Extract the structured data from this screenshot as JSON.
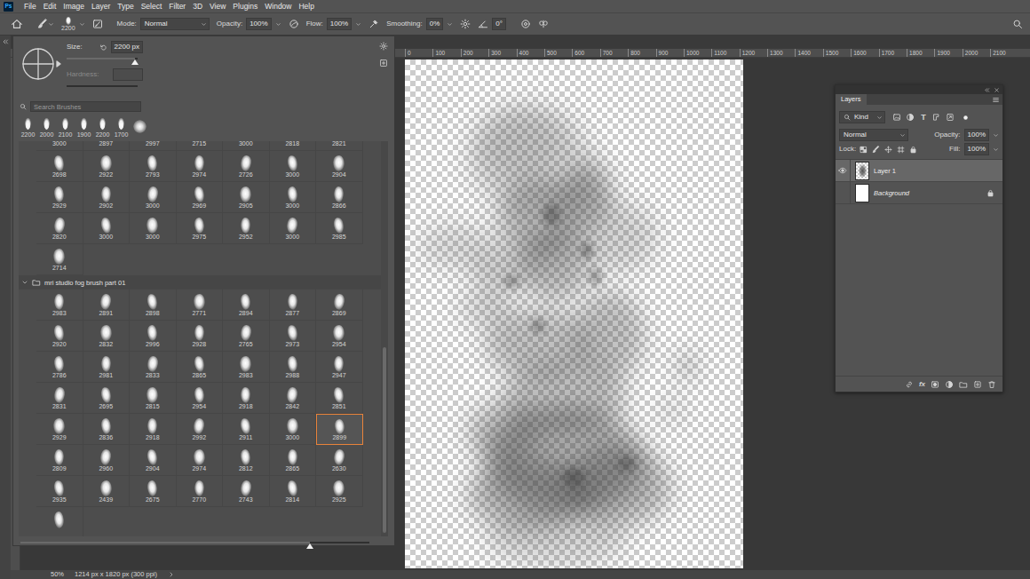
{
  "app": {
    "logo": "Ps"
  },
  "menu": [
    "File",
    "Edit",
    "Image",
    "Layer",
    "Type",
    "Select",
    "Filter",
    "3D",
    "View",
    "Plugins",
    "Window",
    "Help"
  ],
  "options_bar": {
    "brush_size": "2200",
    "mode_label": "Mode:",
    "mode": "Normal",
    "opacity_label": "Opacity:",
    "opacity": "100%",
    "flow_label": "Flow:",
    "flow": "100%",
    "smoothing_label": "Smoothing:",
    "smoothing": "0%",
    "angle": "0°"
  },
  "brush_panel": {
    "size_label": "Size:",
    "size": "2200 px",
    "size_level": 0.96,
    "hardness_label": "Hardness:",
    "hardness_disabled": true,
    "search": {
      "placeholder": "Search Brushes"
    },
    "recent": [
      {
        "kind": "tip",
        "size": "2200"
      },
      {
        "kind": "tip",
        "size": "2000"
      },
      {
        "kind": "tip",
        "size": "2100"
      },
      {
        "kind": "tip",
        "size": "1900"
      },
      {
        "kind": "tip",
        "size": "2200"
      },
      {
        "kind": "tip",
        "size": "1700"
      },
      {
        "kind": "round"
      }
    ],
    "groups": [
      {
        "items": [
          {
            "size": "3000",
            "selected": false
          },
          {
            "size": "2897",
            "selected": false
          },
          {
            "size": "2997",
            "selected": false
          },
          {
            "size": "2715",
            "selected": false
          },
          {
            "size": "3000",
            "selected": false
          },
          {
            "size": "2818",
            "selected": false
          },
          {
            "size": "2821",
            "selected": false
          },
          {
            "size": "2698",
            "selected": false
          },
          {
            "size": "2922",
            "selected": false
          },
          {
            "size": "2793",
            "selected": false
          },
          {
            "size": "2974",
            "selected": false
          },
          {
            "size": "2726",
            "selected": false
          },
          {
            "size": "3000",
            "selected": false
          },
          {
            "size": "2904",
            "selected": false
          },
          {
            "size": "2929",
            "selected": false
          },
          {
            "size": "2902",
            "selected": false
          },
          {
            "size": "3000",
            "selected": false
          },
          {
            "size": "2969",
            "selected": false
          },
          {
            "size": "2905",
            "selected": false
          },
          {
            "size": "3000",
            "selected": false
          },
          {
            "size": "2866",
            "selected": false
          },
          {
            "size": "2820",
            "selected": false
          },
          {
            "size": "3000",
            "selected": false
          },
          {
            "size": "3000",
            "selected": false
          },
          {
            "size": "2975",
            "selected": false
          },
          {
            "size": "2952",
            "selected": false
          },
          {
            "size": "3000",
            "selected": false
          },
          {
            "size": "2985",
            "selected": false
          },
          {
            "size": "2714",
            "selected": false
          }
        ]
      },
      {
        "name": "mri studio fog brush part 01",
        "expanded": true,
        "items": [
          {
            "size": "2983",
            "selected": false
          },
          {
            "size": "2891",
            "selected": false
          },
          {
            "size": "2898",
            "selected": false
          },
          {
            "size": "2771",
            "selected": false
          },
          {
            "size": "2894",
            "selected": false
          },
          {
            "size": "2877",
            "selected": false
          },
          {
            "size": "2869",
            "selected": false
          },
          {
            "size": "2920",
            "selected": false
          },
          {
            "size": "2832",
            "selected": false
          },
          {
            "size": "2996",
            "selected": false
          },
          {
            "size": "2928",
            "selected": false
          },
          {
            "size": "2765",
            "selected": false
          },
          {
            "size": "2973",
            "selected": false
          },
          {
            "size": "2954",
            "selected": false
          },
          {
            "size": "2786",
            "selected": false
          },
          {
            "size": "2981",
            "selected": false
          },
          {
            "size": "2833",
            "selected": false
          },
          {
            "size": "2865",
            "selected": false
          },
          {
            "size": "2983",
            "selected": false
          },
          {
            "size": "2988",
            "selected": false
          },
          {
            "size": "2947",
            "selected": false
          },
          {
            "size": "2831",
            "selected": false
          },
          {
            "size": "2695",
            "selected": false
          },
          {
            "size": "2815",
            "selected": false
          },
          {
            "size": "2954",
            "selected": false
          },
          {
            "size": "2918",
            "selected": false
          },
          {
            "size": "2842",
            "selected": false
          },
          {
            "size": "2851",
            "selected": false
          },
          {
            "size": "2929",
            "selected": false
          },
          {
            "size": "2836",
            "selected": false
          },
          {
            "size": "2918",
            "selected": false
          },
          {
            "size": "2992",
            "selected": false
          },
          {
            "size": "2911",
            "selected": false
          },
          {
            "size": "3000",
            "selected": false
          },
          {
            "size": "2899",
            "selected": true
          },
          {
            "size": "2809",
            "selected": false
          },
          {
            "size": "2960",
            "selected": false
          },
          {
            "size": "2904",
            "selected": false
          },
          {
            "size": "2974",
            "selected": false
          },
          {
            "size": "2812",
            "selected": false
          },
          {
            "size": "2865",
            "selected": false
          },
          {
            "size": "2630",
            "selected": false
          },
          {
            "size": "2935",
            "selected": false
          },
          {
            "size": "2439",
            "selected": false
          },
          {
            "size": "2675",
            "selected": false
          },
          {
            "size": "2770",
            "selected": false
          },
          {
            "size": "2743",
            "selected": false
          },
          {
            "size": "2814",
            "selected": false
          },
          {
            "size": "2925",
            "selected": false
          },
          {
            "selected": false
          }
        ]
      }
    ],
    "preview_level": 0.83
  },
  "ruler": {
    "labels": [
      "0",
      "100",
      "200",
      "300",
      "400",
      "500",
      "600",
      "700",
      "800",
      "900",
      "1000",
      "1100",
      "1200",
      "1300",
      "1400",
      "1500",
      "1600",
      "1700",
      "1800",
      "1900",
      "2000",
      "2100"
    ]
  },
  "layers_panel": {
    "tabs": [
      {
        "label": "Layers",
        "selected": true
      }
    ],
    "filter": "Kind",
    "type_filter": "T",
    "blend_mode": "Normal",
    "opacity_label": "Opacity:",
    "opacity": "100%",
    "lock_label": "Lock:",
    "fill_label": "Fill:",
    "fill": "100%",
    "layers": [
      {
        "name": "Layer 1",
        "visible": true,
        "selected": true,
        "locked": false,
        "kind": "art"
      },
      {
        "name": "Background",
        "visible": false,
        "selected": false,
        "locked": true,
        "kind": "white"
      }
    ],
    "fx": "fx"
  },
  "status_bar": {
    "zoom": "50%",
    "dimensions": "1214 px x 1820 px (300 ppi)"
  }
}
